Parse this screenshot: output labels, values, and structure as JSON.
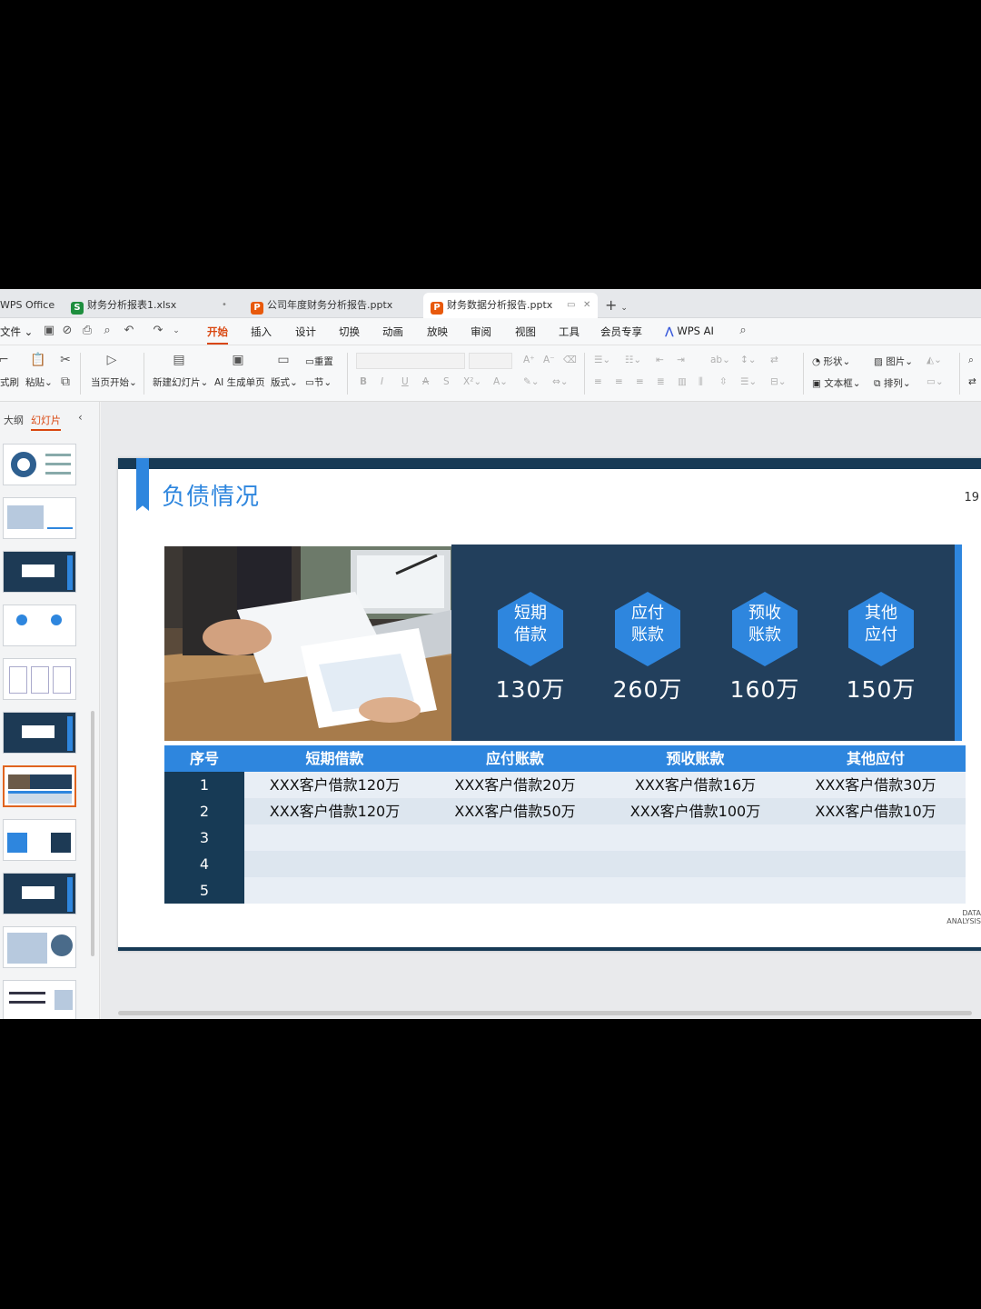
{
  "tabs": [
    {
      "label": "WPS Office",
      "badge": ""
    },
    {
      "label": "财务分析报表1.xlsx",
      "badge": "S",
      "badge_color": "#1e8e3e"
    },
    {
      "label": "公司年度财务分析报告.pptx",
      "badge": "P",
      "badge_color": "#e8590c"
    },
    {
      "label": "财务数据分析报告.pptx",
      "badge": "P",
      "badge_color": "#e8590c"
    }
  ],
  "new_tab": "+",
  "menu": {
    "file": "文件",
    "items": [
      "开始",
      "插入",
      "设计",
      "切换",
      "动画",
      "放映",
      "审阅",
      "视图",
      "工具",
      "会员专享"
    ],
    "active": "开始",
    "ai": "WPS AI"
  },
  "ribbon": {
    "format_painter": "式刷",
    "paste": "粘贴",
    "play_current": "当页开始",
    "new_slide": "新建幻灯片",
    "ai_single": "AI 生成单页",
    "layout": "版式",
    "reset": "重置",
    "section": "节",
    "shape": "形状",
    "picture": "图片",
    "textbox": "文本框",
    "arrange": "排列"
  },
  "left_panel": {
    "outline_tab": "大纲",
    "slides_tab": "幻灯片"
  },
  "slide": {
    "title": "负债情况",
    "page_number": "19",
    "footer_line1": "DATA",
    "footer_line2": "ANALYSIS",
    "stats": [
      {
        "line1": "短期",
        "line2": "借款",
        "value": "130万"
      },
      {
        "line1": "应付",
        "line2": "账款",
        "value": "260万"
      },
      {
        "line1": "预收",
        "line2": "账款",
        "value": "160万"
      },
      {
        "line1": "其他",
        "line2": "应付",
        "value": "150万"
      }
    ],
    "table": {
      "headers": [
        "序号",
        "短期借款",
        "应付账款",
        "预收账款",
        "其他应付"
      ],
      "rows": [
        [
          "1",
          "XXX客户借款120万",
          "XXX客户借款20万",
          "XXX客户借款16万",
          "XXX客户借款30万"
        ],
        [
          "2",
          "XXX客户借款120万",
          "XXX客户借款50万",
          "XXX客户借款100万",
          "XXX客户借款10万"
        ],
        [
          "3",
          "",
          "",
          "",
          ""
        ],
        [
          "4",
          "",
          "",
          "",
          ""
        ],
        [
          "5",
          "",
          "",
          "",
          ""
        ]
      ]
    }
  },
  "colors": {
    "accent": "#2e86de",
    "navy": "#173a55",
    "panel": "#223f5c",
    "ribbon_active": "#d9460f"
  }
}
